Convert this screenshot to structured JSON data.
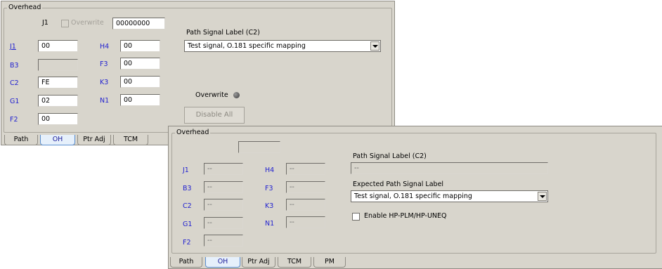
{
  "panel1": {
    "group_title": "Overhead",
    "j1_label": "J1",
    "overwrite_checkbox_label": "Overwrite",
    "j1_hex_value": "00000000",
    "path_signal_label_title": "Path Signal Label (C2)",
    "path_signal_label_value": "Test signal, O.181 specific mapping",
    "fields": {
      "J1": "00",
      "B3": "",
      "C2": "FE",
      "G1": "02",
      "F2": "00",
      "H4": "00",
      "F3": "00",
      "K3": "00",
      "N1": "00"
    },
    "labels": {
      "J1": "J1",
      "B3": "B3",
      "C2": "C2",
      "G1": "G1",
      "F2": "F2",
      "H4": "H4",
      "F3": "F3",
      "K3": "K3",
      "N1": "N1"
    },
    "overwrite_led_label": "Overwrite",
    "disable_all_label": "Disable All",
    "tabs": [
      "Path",
      "OH",
      "Ptr Adj",
      "TCM"
    ]
  },
  "panel2": {
    "group_title": "Overhead",
    "top_field_value": "",
    "path_signal_label_title": "Path Signal Label (C2)",
    "path_signal_label_value": "--",
    "expected_label_title": "Expected Path Signal Label",
    "expected_label_value": "Test signal, O.181 specific mapping",
    "enable_checkbox_label": "Enable HP-PLM/HP-UNEQ",
    "fields": {
      "J1": "--",
      "B3": "--",
      "C2": "--",
      "G1": "--",
      "F2": "--",
      "H4": "--",
      "F3": "--",
      "K3": "--",
      "N1": "--"
    },
    "labels": {
      "J1": "J1",
      "B3": "B3",
      "C2": "C2",
      "G1": "G1",
      "F2": "F2",
      "H4": "H4",
      "F3": "F3",
      "K3": "K3",
      "N1": "N1"
    },
    "tabs": [
      "Path",
      "OH",
      "Ptr Adj",
      "TCM",
      "PM"
    ]
  }
}
